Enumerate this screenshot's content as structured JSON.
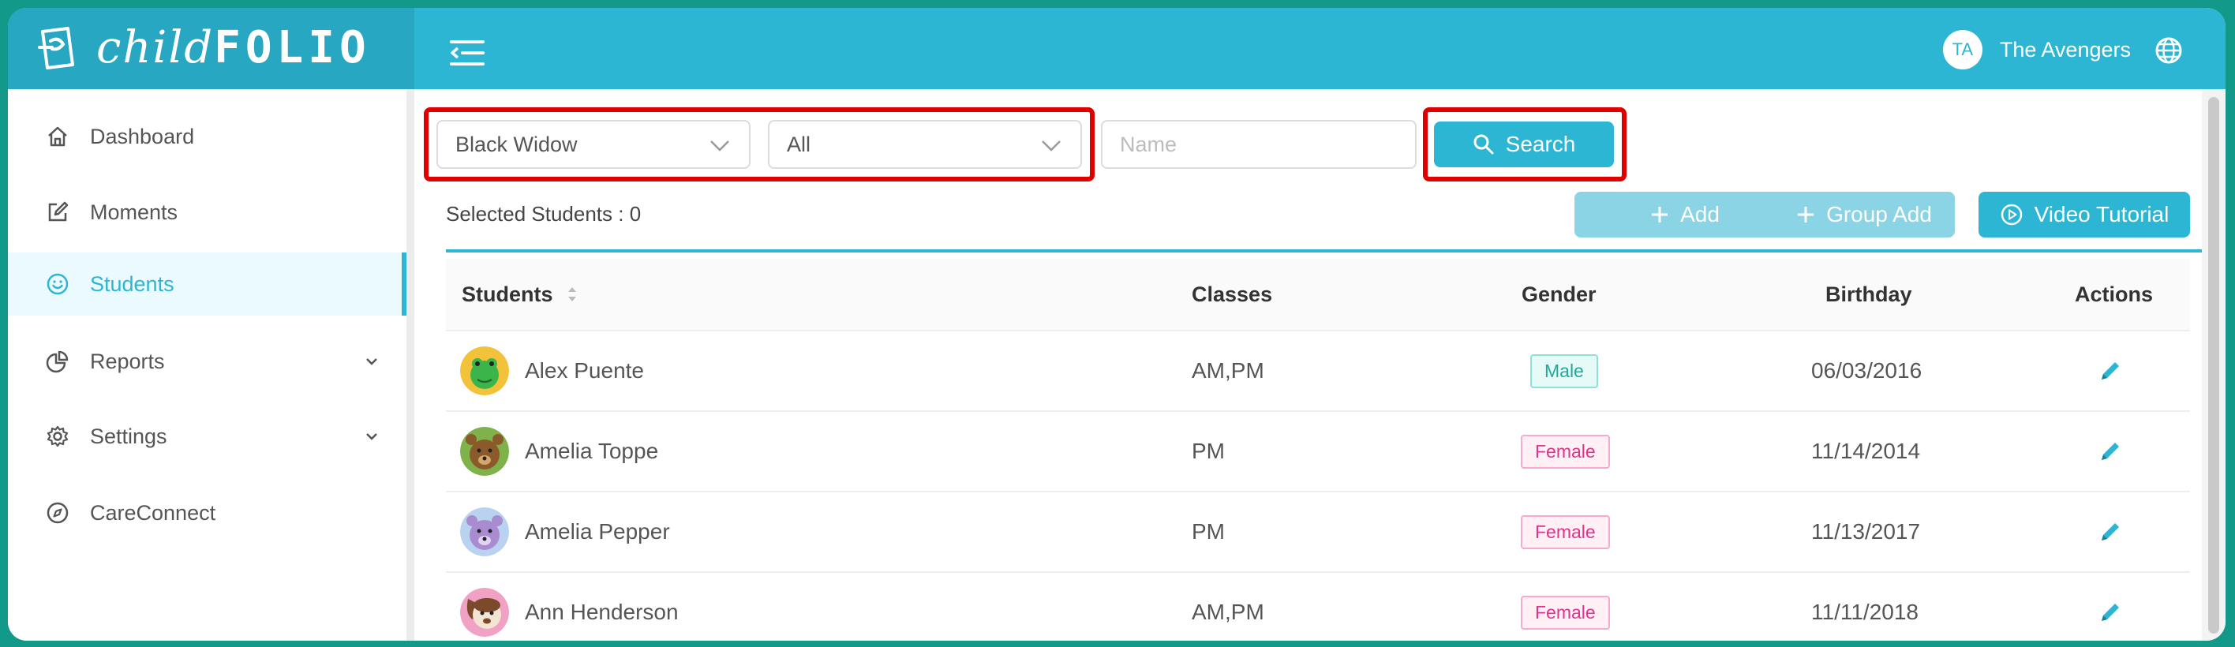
{
  "brand": {
    "name_prefix": "child",
    "name_suffix": "FOLIO"
  },
  "header": {
    "user_initials": "TA",
    "user_name": "The Avengers"
  },
  "sidebar": {
    "items": [
      {
        "label": "Dashboard",
        "icon": "home-icon"
      },
      {
        "label": "Moments",
        "icon": "edit-icon"
      },
      {
        "label": "Students",
        "icon": "smile-icon",
        "active": true
      },
      {
        "label": "Reports",
        "icon": "pie-chart-icon",
        "expandable": true
      },
      {
        "label": "Settings",
        "icon": "gear-icon",
        "expandable": true
      },
      {
        "label": "CareConnect",
        "icon": "compass-icon"
      }
    ]
  },
  "filters": {
    "class_select": "Black Widow",
    "status_select": "All",
    "name_placeholder": "Name",
    "search_label": "Search"
  },
  "toolbar": {
    "selected_students": "Selected Students : 0",
    "add_label": "Add",
    "group_add_label": "Group Add",
    "video_tutorial_label": "Video Tutorial"
  },
  "table": {
    "columns": [
      "Students",
      "Classes",
      "Gender",
      "Birthday",
      "Actions"
    ],
    "rows": [
      {
        "name": "Alex Puente",
        "classes": "AM,PM",
        "gender": "Male",
        "birthday": "06/03/2016",
        "avatar": "frog"
      },
      {
        "name": "Amelia Toppe",
        "classes": "PM",
        "gender": "Female",
        "birthday": "11/14/2014",
        "avatar": "bear"
      },
      {
        "name": "Amelia Pepper",
        "classes": "PM",
        "gender": "Female",
        "birthday": "11/13/2017",
        "avatar": "purple-bear"
      },
      {
        "name": "Ann Henderson",
        "classes": "AM,PM",
        "gender": "Female",
        "birthday": "11/11/2018",
        "avatar": "dog"
      }
    ]
  },
  "colors": {
    "accent": "#2db6d3",
    "highlight": "#e00000",
    "frame": "#13998a"
  }
}
